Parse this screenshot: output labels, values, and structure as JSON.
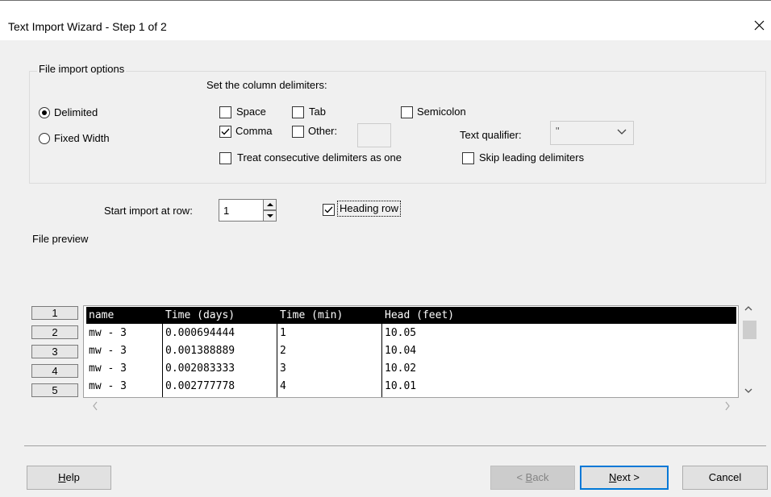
{
  "window": {
    "title": "Text Import Wizard - Step 1 of 2"
  },
  "file_import_options": {
    "legend": "File import options",
    "radio_delimited": "Delimited",
    "radio_fixed_width": "Fixed Width",
    "selected": "Delimited"
  },
  "delimiters": {
    "label": "Set the column delimiters:",
    "space": {
      "label": "Space",
      "checked": false
    },
    "tab": {
      "label": "Tab",
      "checked": false
    },
    "semicolon": {
      "label": "Semicolon",
      "checked": false
    },
    "comma": {
      "label": "Comma",
      "checked": true
    },
    "other": {
      "label": "Other:",
      "checked": false,
      "value": ""
    },
    "consecutive": {
      "label": "Treat consecutive delimiters as one",
      "checked": false
    },
    "skip_leading": {
      "label": "Skip leading delimiters",
      "checked": false
    },
    "text_qualifier_label": "Text qualifier:",
    "text_qualifier_value": "\""
  },
  "start_row": {
    "label": "Start import at row:",
    "value": "1"
  },
  "heading_row": {
    "label": "Heading row",
    "checked": true
  },
  "preview": {
    "label": "File preview",
    "row_numbers": [
      "1",
      "2",
      "3",
      "4",
      "5"
    ],
    "header": [
      "name",
      "Time (days)",
      "Time (min)",
      "Head (feet)"
    ],
    "rows": [
      [
        "mw - 3",
        "0.000694444",
        "1",
        "10.05"
      ],
      [
        "mw - 3",
        "0.001388889",
        "2",
        "10.04"
      ],
      [
        "mw - 3",
        "0.002083333",
        "3",
        "10.02"
      ],
      [
        "mw - 3",
        "0.002777778",
        "4",
        "10.01"
      ]
    ]
  },
  "buttons": {
    "help_prefix": "",
    "help_mnemonic": "H",
    "help_rest": "elp",
    "back_prefix": "< ",
    "back_mnemonic": "B",
    "back_rest": "ack",
    "next_prefix": "",
    "next_mnemonic": "N",
    "next_rest": "ext >",
    "cancel": "Cancel"
  },
  "icons": {
    "close": "close-icon",
    "checkmark": "checkmark-icon",
    "chevron_down": "chevron-down-icon",
    "spin_up": "triangle-up-icon",
    "spin_down": "triangle-down-icon",
    "scroll_up": "chevron-up-icon",
    "scroll_down": "chevron-down-icon",
    "scroll_left": "chevron-left-icon",
    "scroll_right": "chevron-right-icon"
  },
  "colors": {
    "default_button_border": "#0078d7",
    "preview_header_bg": "#000000"
  }
}
